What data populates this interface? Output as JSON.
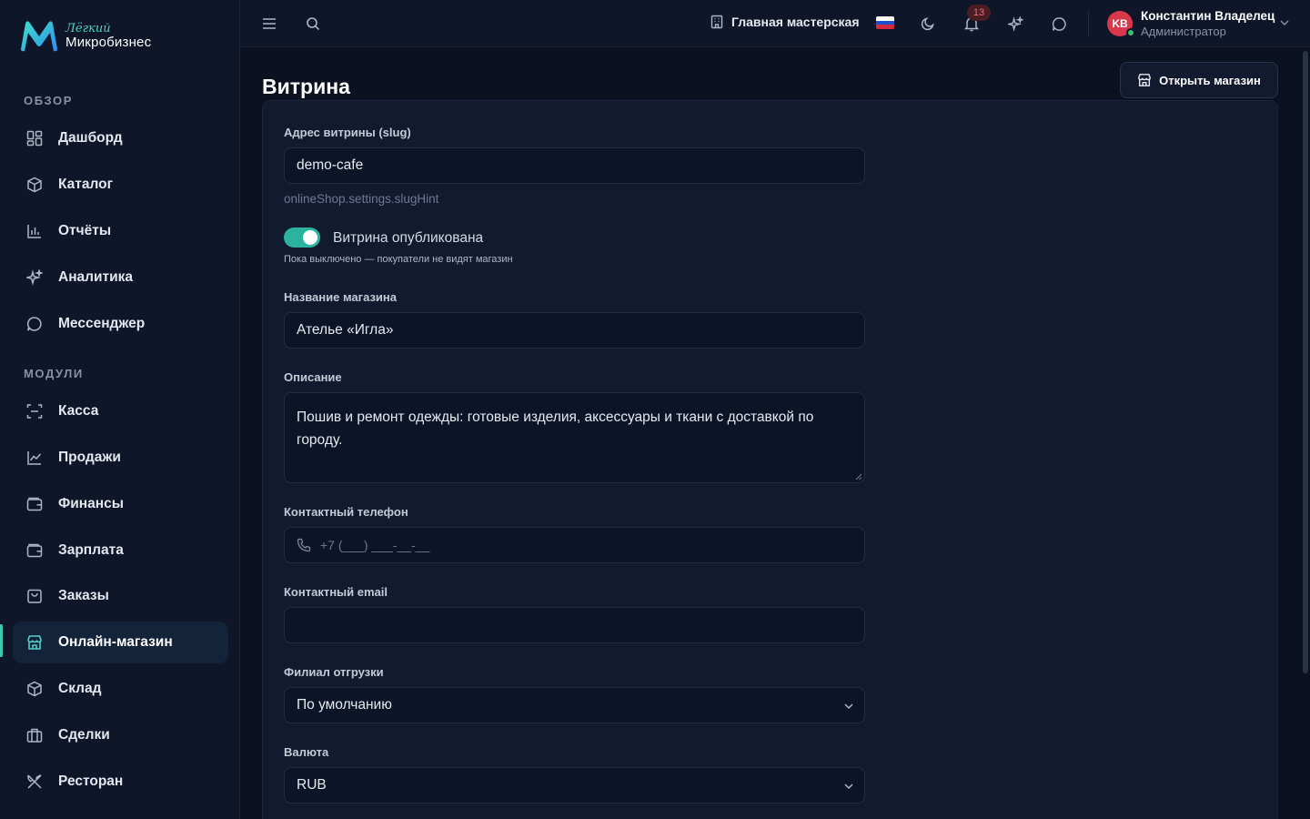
{
  "brand": {
    "tagline": "Лёгкий",
    "name": "Микробизнес"
  },
  "sidebar": {
    "section_overview": "ОБЗОР",
    "section_modules": "МОДУЛИ",
    "overview_items": [
      {
        "label": "Дашборд",
        "icon": "dashboard-icon"
      },
      {
        "label": "Каталог",
        "icon": "catalog-icon"
      },
      {
        "label": "Отчёты",
        "icon": "reports-icon"
      },
      {
        "label": "Аналитика",
        "icon": "analytics-icon"
      },
      {
        "label": "Мессенджер",
        "icon": "messenger-icon"
      }
    ],
    "module_items": [
      {
        "label": "Касса",
        "icon": "cashbox-icon"
      },
      {
        "label": "Продажи",
        "icon": "sales-icon"
      },
      {
        "label": "Финансы",
        "icon": "finance-icon"
      },
      {
        "label": "Зарплата",
        "icon": "salary-icon"
      },
      {
        "label": "Заказы",
        "icon": "orders-icon"
      },
      {
        "label": "Онлайн-магазин",
        "icon": "store-icon",
        "active": true
      },
      {
        "label": "Склад",
        "icon": "warehouse-icon"
      },
      {
        "label": "Сделки",
        "icon": "deals-icon"
      },
      {
        "label": "Ресторан",
        "icon": "restaurant-icon"
      }
    ]
  },
  "topbar": {
    "workshop": "Главная мастерская",
    "notifications_count": "13",
    "user": {
      "initials": "KB",
      "name": "Константин Владелец",
      "role": "Администратор"
    }
  },
  "page": {
    "title": "Витрина",
    "open_shop_label": "Открыть магазин"
  },
  "form": {
    "slug_label": "Адрес витрины (slug)",
    "slug_value": "demo-cafe",
    "slug_hint": "onlineShop.settings.slugHint",
    "published_label": "Витрина опубликована",
    "published": true,
    "published_hint": "Пока выключено — покупатели не видят магазин",
    "name_label": "Название магазина",
    "name_value": "Ателье «Игла»",
    "description_label": "Описание",
    "description_value": "Пошив и ремонт одежды: готовые изделия, аксессуары и ткани с доставкой по городу.",
    "phone_label": "Контактный телефон",
    "phone_placeholder": "+7 (___) ___-__-__",
    "email_label": "Контактный email",
    "email_value": "",
    "branch_label": "Филиал отгрузки",
    "branch_value": "По умолчанию",
    "currency_label": "Валюта",
    "currency_value": "RUB"
  },
  "colors": {
    "accent": "#2cb3a0",
    "background": "#0b1120",
    "card": "#111a2e",
    "badge": "#f06a78"
  }
}
